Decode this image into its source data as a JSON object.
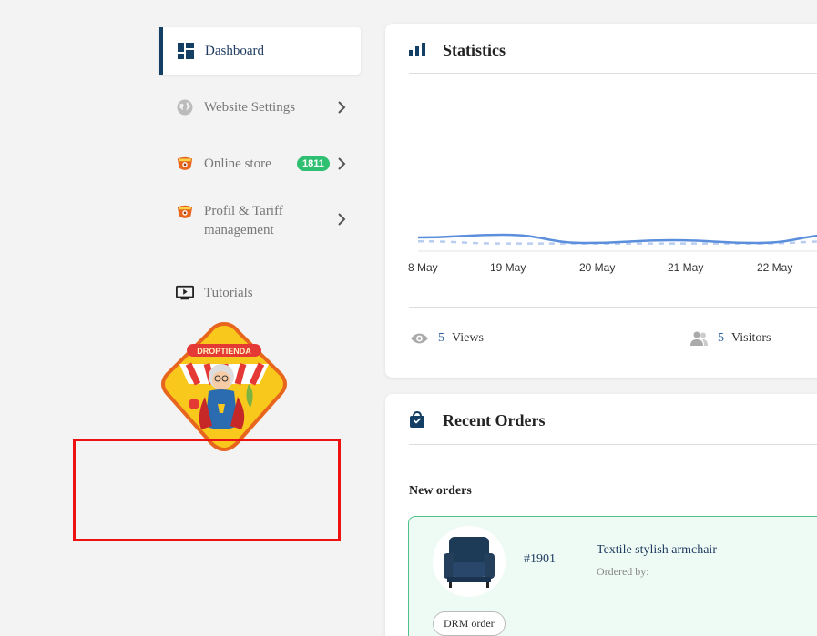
{
  "sidebar": {
    "items": [
      {
        "label": "Dashboard",
        "icon": "dashboard-icon",
        "active": true
      },
      {
        "label": "Website Settings",
        "icon": "globe-icon"
      },
      {
        "label": "Online store",
        "icon": "store-mascot-icon",
        "badge": "1811"
      },
      {
        "label": "Profil & Tariff management",
        "icon": "store-mascot-icon"
      },
      {
        "label": "Tutorials",
        "icon": "video-monitor-icon"
      }
    ]
  },
  "logo": {
    "text": "DROPTIENDA"
  },
  "statistics": {
    "title": "Statistics",
    "icon": "bar-chart-icon",
    "x_ticks": [
      "8 May",
      "19 May",
      "20 May",
      "21 May",
      "22 May"
    ],
    "views_count": "5",
    "views_label": "Views",
    "visitors_count": "5",
    "visitors_label": "Visitors"
  },
  "chart_data": {
    "type": "line",
    "categories": [
      "8 May",
      "19 May",
      "20 May",
      "21 May",
      "22 May"
    ],
    "series": [
      {
        "values": [
          1.5,
          2,
          0.5,
          1,
          0.5,
          2
        ],
        "style": "solid",
        "color": "#5b8fdc"
      },
      {
        "values": [
          0.8,
          0.4,
          0.4,
          0.4,
          0.4,
          0.8
        ],
        "style": "dashed",
        "color": "#b9cdef"
      }
    ],
    "grid": false
  },
  "orders": {
    "title": "Recent Orders",
    "icon": "shopping-bag-icon",
    "subheading": "New orders",
    "order": {
      "id": "#1901",
      "product": "Textile stylish armchair",
      "ordered_by": "Ordered by:",
      "tag": "DRM order",
      "image": "armchair-image"
    }
  },
  "colors": {
    "accent": "#123f63",
    "badge": "#2fbf71",
    "order_border": "#4cc28a",
    "highlight_box": "#e11111"
  }
}
